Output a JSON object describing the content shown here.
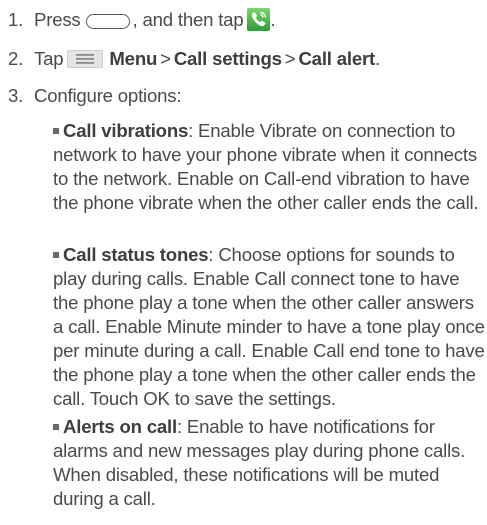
{
  "steps": [
    {
      "num": "1.",
      "text_a": "Press",
      "text_b": ", and then tap",
      "text_c": "."
    },
    {
      "num": "2.",
      "text_a": "Tap",
      "menu": "Menu",
      "sep1": ">",
      "call_settings": "Call settings",
      "sep2": ">",
      "call_alert": "Call alert",
      "end": "."
    },
    {
      "num": "3.",
      "text": "Configure options:"
    }
  ],
  "options": [
    {
      "title": "Call vibrations",
      "desc": ": Enable Vibrate on connection to network to have your phone vibrate when it connects to the network. Enable on Call-end vibration to have the phone vibrate when the other caller ends the call."
    },
    {
      "title": "Call status tones",
      "desc": ": Choose options for sounds to play during calls. Enable Call connect tone to have the phone play a tone when the other caller answers a call. Enable Minute minder to have a tone play once per minute during a call. Enable Call end tone to have the phone play a tone when the other caller ends the call. Touch OK to save the settings."
    },
    {
      "title": "Alerts on call",
      "desc": ": Enable to have notifications for alarms and new messages play during phone calls. When disabled, these notifications will be muted during a call."
    }
  ],
  "icons": {
    "home_key": "home-key-icon",
    "phone_app": "phone-app-icon",
    "menu_key": "menu-key-icon"
  },
  "colors": {
    "text": "#4a4a4a",
    "phone_icon_bg": "#4caf50",
    "bullet": "#6a6a6a"
  }
}
